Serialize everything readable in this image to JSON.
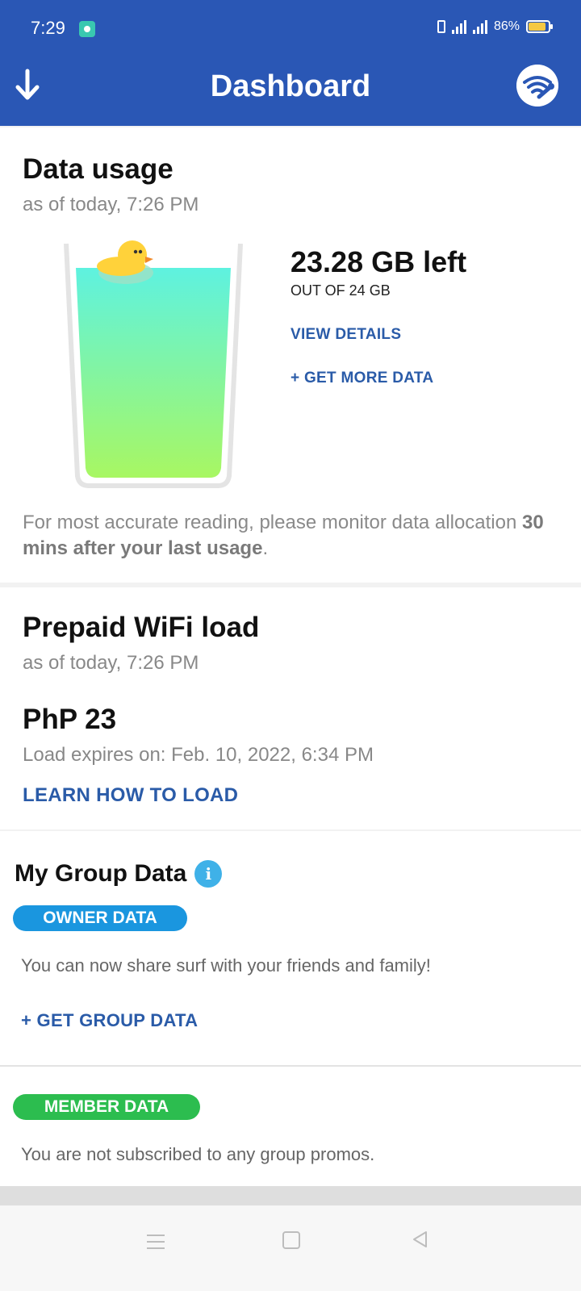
{
  "status": {
    "time": "7:29",
    "battery": "86%"
  },
  "header": {
    "title": "Dashboard"
  },
  "data_usage": {
    "title": "Data usage",
    "timestamp": "as of today, 7:26 PM",
    "left": "23.28 GB left",
    "total": "OUT OF 24 GB",
    "remaining_fraction": 0.97,
    "view_details": "VIEW DETAILS",
    "get_more": "+ GET MORE DATA",
    "note_prefix": "For most accurate reading, please monitor data allocation ",
    "note_bold": "30 mins after your last usage",
    "note_suffix": "."
  },
  "wifi_load": {
    "title": "Prepaid WiFi load",
    "timestamp": "as of today, 7:26 PM",
    "amount": "PhP 23",
    "expiry": "Load expires on: Feb. 10, 2022, 6:34 PM",
    "learn": "LEARN HOW TO LOAD"
  },
  "group_data": {
    "title": "My Group Data",
    "owner_label": "OWNER DATA",
    "owner_text": "You can now share surf with your friends and family!",
    "get_group": "+ GET GROUP DATA",
    "member_label": "MEMBER DATA",
    "member_text": "You are not subscribed to any group promos."
  },
  "colors": {
    "header": "#2a57b5",
    "link": "#2a5ba8",
    "owner_pill": "#1a96df",
    "member_pill": "#2cbd4f",
    "info": "#3fb1e8"
  },
  "icons": [
    "download-arrow-icon",
    "wifi-wrench-icon",
    "info-icon",
    "duck-icon",
    "nav-menu-icon",
    "nav-home-icon",
    "nav-back-icon"
  ]
}
